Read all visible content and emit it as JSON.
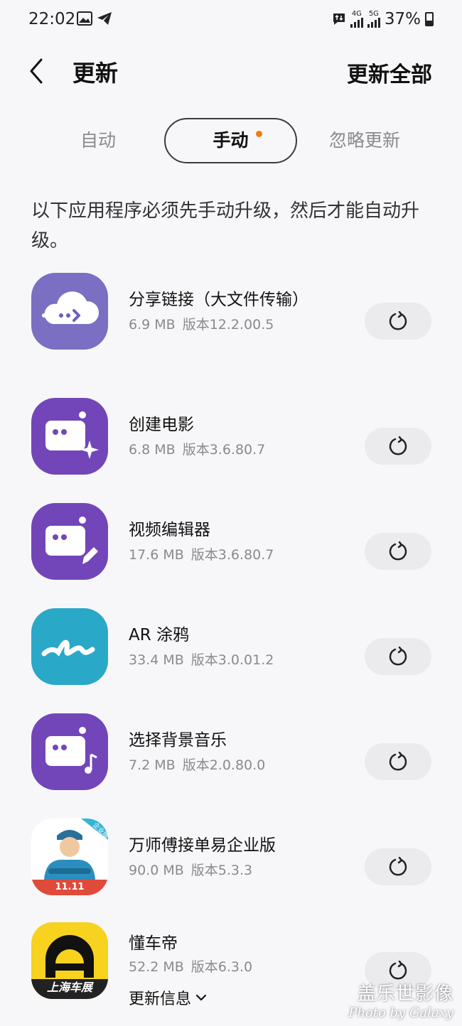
{
  "status_bar": {
    "time": "22:02",
    "net1": "4G",
    "net2": "5G",
    "battery": "37%"
  },
  "header": {
    "title": "更新",
    "update_all": "更新全部"
  },
  "tabs": {
    "auto": "自动",
    "manual": "手动",
    "ignore": "忽略更新",
    "selected": "manual"
  },
  "description": "以下应用程序必须先手动升级，然后才能自动升级。",
  "apps": [
    {
      "name": "分享链接（大文件传输）",
      "size": "6.9 MB",
      "version": "版本12.2.00.5",
      "icon": "cloud-share-icon",
      "color": "#7a6fc2"
    },
    {
      "name": "创建电影",
      "size": "6.8 MB",
      "version": "版本3.6.80.7",
      "icon": "movie-maker-icon",
      "color": "#7246b8"
    },
    {
      "name": "视频编辑器",
      "size": "17.6 MB",
      "version": "版本3.6.80.7",
      "icon": "video-editor-icon",
      "color": "#7246b8"
    },
    {
      "name": "AR 涂鸦",
      "size": "33.4 MB",
      "version": "版本3.0.01.2",
      "icon": "ar-doodle-icon",
      "color": "#2aa8c8"
    },
    {
      "name": "选择背景音乐",
      "size": "7.2 MB",
      "version": "版本2.0.80.0",
      "icon": "background-music-icon",
      "color": "#7246b8"
    },
    {
      "name": "万师傅接单易企业版",
      "size": "90.0 MB",
      "version": "版本5.3.3",
      "icon": "worker-avatar-icon",
      "badge": "企业版",
      "banner": "11.11",
      "color": "#2aa0c8"
    },
    {
      "name": "懂车帝",
      "size": "52.2 MB",
      "version": "版本6.3.0",
      "icon": "dongchedi-icon",
      "banner": "上海车展",
      "more": "更新信息",
      "color": "#f7d21e"
    }
  ],
  "watermark": {
    "line1": "盖乐世影像",
    "line2": "Photo by Galaxy"
  }
}
